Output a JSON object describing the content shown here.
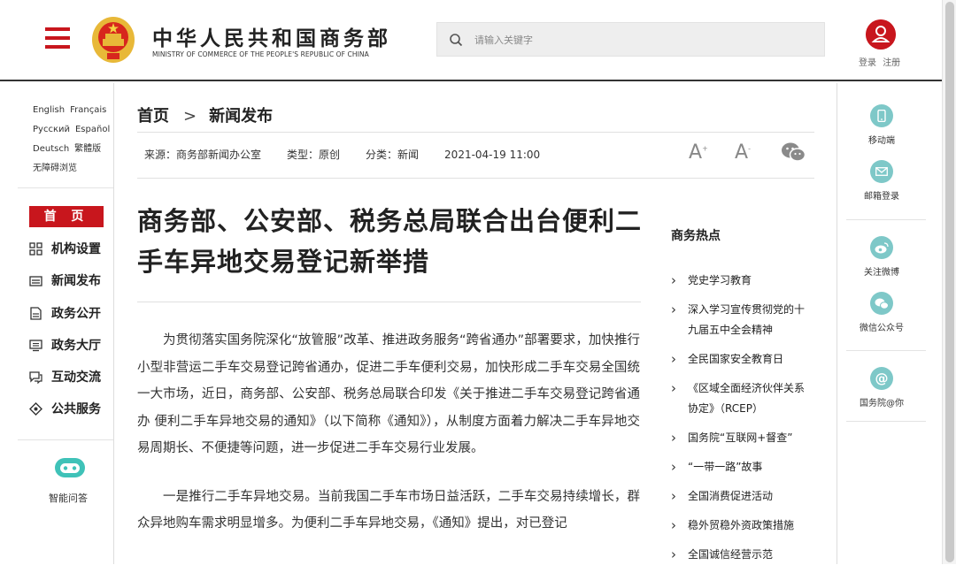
{
  "header": {
    "title_cn": "中华人民共和国商务部",
    "title_en": "MINISTRY OF COMMERCE OF THE PEOPLE'S REPUBLIC OF CHINA",
    "search_placeholder": "请输入关键字",
    "login": "登录",
    "register": "注册"
  },
  "languages": [
    "English",
    "Français",
    "Русский",
    "Español",
    "Deutsch",
    "繁體版",
    "无障碍浏览"
  ],
  "nav": {
    "home": "首 页",
    "items": [
      "机构设置",
      "新闻发布",
      "政务公开",
      "政务大厅",
      "互动交流",
      "公共服务"
    ],
    "assistant": "智能问答"
  },
  "breadcrumb": {
    "home": "首页",
    "sep": ">",
    "current": "新闻发布"
  },
  "meta": {
    "source": "来源：商务部新闻办公室",
    "type": "类型：原创",
    "category": "分类：新闻",
    "date": "2021-04-19 11:00",
    "font_large": "A",
    "font_small": "A"
  },
  "article": {
    "title": "商务部、公安部、税务总局联合出台便利二手车异地交易登记新举措",
    "paragraphs": [
      "为贯彻落实国务院深化“放管服”改革、推进政务服务“跨省通办”部署要求，加快推行小型非营运二手车交易登记跨省通办，促进二手车便利交易，加快形成二手车交易全国统一大市场，近日，商务部、公安部、税务总局联合印发《关于推进二手车交易登记跨省通办 便利二手车异地交易的通知》（以下简称《通知》），从制度方面着力解决二手车异地交易周期长、不便捷等问题，进一步促进二手车交易行业发展。",
      "一是推行二手车异地交易。当前我国二手车市场日益活跃，二手车交易持续增长，群众异地购车需求明显增多。为便利二手车异地交易，《通知》提出，对已登记"
    ]
  },
  "hot": {
    "title": "商务热点",
    "items": [
      "党史学习教育",
      "深入学习宣传贯彻党的十九届五中全会精神",
      "全民国家安全教育日",
      "《区域全面经济伙伴关系协定》（RCEP）",
      "国务院“互联网+督查”",
      "“一带一路”故事",
      "全国消费促进活动",
      "稳外贸稳外资政策措施",
      "全国诚信经营示范"
    ]
  },
  "right": {
    "mobile": "移动端",
    "email": "邮箱登录",
    "weibo": "关注微博",
    "wechat": "微信公众号",
    "state_council": "国务院@你"
  }
}
